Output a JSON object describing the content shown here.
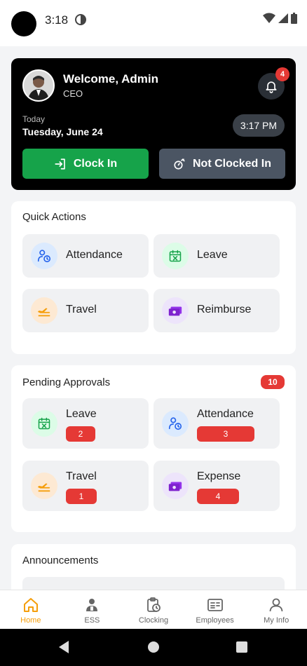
{
  "status_bar": {
    "time": "3:18"
  },
  "header": {
    "welcome": "Welcome, Admin",
    "role": "CEO",
    "notifications_count": "4",
    "today_label": "Today",
    "date": "Tuesday, June 24",
    "current_time": "3:17 PM",
    "clock_in_label": "Clock In",
    "status_label": "Not Clocked In"
  },
  "quick_actions": {
    "title": "Quick Actions",
    "items": [
      {
        "label": "Attendance",
        "icon": "attendance-icon"
      },
      {
        "label": "Leave",
        "icon": "calendar-x-icon"
      },
      {
        "label": "Travel",
        "icon": "plane-icon"
      },
      {
        "label": "Reimburse",
        "icon": "money-icon"
      }
    ]
  },
  "pending_approvals": {
    "title": "Pending Approvals",
    "total": "10",
    "items": [
      {
        "label": "Leave",
        "count": "2",
        "icon": "calendar-x-icon"
      },
      {
        "label": "Attendance",
        "count": "3",
        "icon": "attendance-icon"
      },
      {
        "label": "Travel",
        "count": "1",
        "icon": "plane-icon"
      },
      {
        "label": "Expense",
        "count": "4",
        "icon": "money-icon"
      }
    ]
  },
  "announcements": {
    "title": "Announcements"
  },
  "bottom_nav": {
    "items": [
      {
        "label": "Home",
        "icon": "home-icon"
      },
      {
        "label": "ESS",
        "icon": "person-badge-icon"
      },
      {
        "label": "Clocking",
        "icon": "clipboard-clock-icon"
      },
      {
        "label": "Employees",
        "icon": "id-card-icon"
      },
      {
        "label": "My Info",
        "icon": "user-icon"
      }
    ]
  },
  "colors": {
    "accent": "#f59e0b",
    "clock_in": "#16a34a",
    "badge": "#e53935",
    "hero_bg": "#000000"
  }
}
